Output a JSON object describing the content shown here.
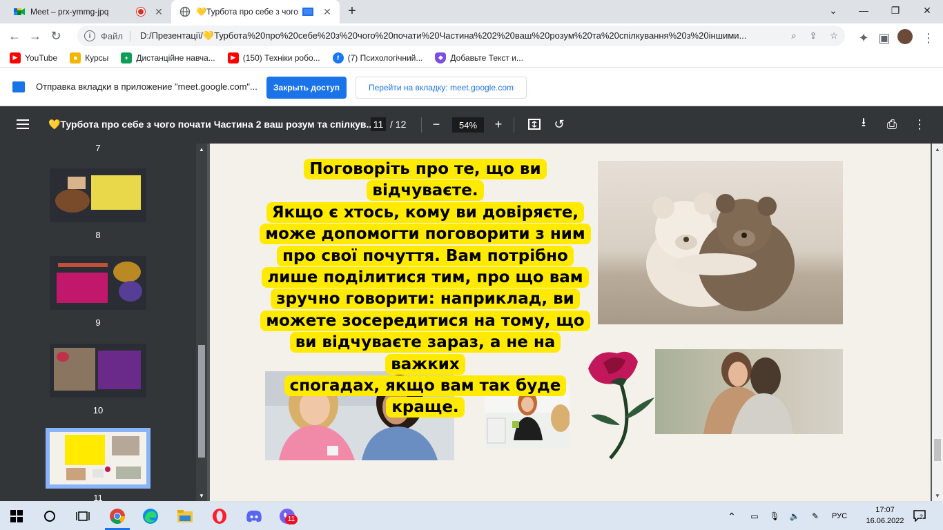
{
  "tabs": [
    {
      "title": "Meet – prx-ymmg-jpq",
      "icon": "google-meet-icon",
      "recording": true
    },
    {
      "title": "💛Турбота про себе з чого",
      "icon": "globe-icon",
      "sharing": true
    }
  ],
  "omnibox": {
    "scheme_label": "Файл",
    "url": "D:/Презентації/💛Турбота%20про%20себе%20з%20чого%20почати%20Частина%202%20ваш%20розум%20та%20спілкування%20з%20іншими..."
  },
  "bookmarks": [
    {
      "label": "YouTube",
      "icon": "youtube-icon",
      "color": "#ff0000"
    },
    {
      "label": "Курсы",
      "icon": "classroom-icon",
      "color": "#f4b400"
    },
    {
      "label": "Дистанційне навча...",
      "icon": "cross-icon",
      "color": "#0f9d58"
    },
    {
      "label": "(150) Техніки робо...",
      "icon": "youtube-icon",
      "color": "#ff0000"
    },
    {
      "label": "(7) Психологічний...",
      "icon": "facebook-icon",
      "color": "#1877f2"
    },
    {
      "label": "Добавьте Текст и...",
      "icon": "shield-icon",
      "color": "#7b4ee4"
    }
  ],
  "infobar": {
    "message": "Отправка вкладки в приложение \"meet.google.com\"...",
    "primary_button": "Закрыть доступ",
    "secondary_button": "Перейти на вкладку: meet.google.com"
  },
  "pdf": {
    "title": "💛Турбота про себе з чого почати Частина 2 ваш розум та спілкув...",
    "current_page": "11",
    "total_pages": "/ 12",
    "zoom": "54%"
  },
  "thumbnails": [
    {
      "label": "7"
    },
    {
      "label": "8"
    },
    {
      "label": "9"
    },
    {
      "label": "10"
    },
    {
      "label": "11",
      "selected": true
    }
  ],
  "slide": {
    "quote_lines": [
      "Поговоріть про те, що ви",
      "відчуваєте.",
      "Якщо є хтось, кому ви довіряєте,",
      "може допомогти поговорити з ним",
      "про свої почуття. Вам потрібно",
      "лише поділитися тим, про що вам",
      "зручно говорити: наприклад, ви",
      "можете зосередитися на тому, що",
      "ви відчуваєте зараз, а не на важких",
      "спогадах, якщо вам так буде краще."
    ],
    "highlight_color": "#ffea00"
  },
  "taskbar": {
    "apps": [
      "windows-start-icon",
      "search-circle-icon",
      "task-view-icon",
      "chrome-icon",
      "edge-icon",
      "file-explorer-icon",
      "opera-icon",
      "discord-icon",
      "viber-icon"
    ],
    "viber_badge": "11",
    "lang": "РУС",
    "time": "17:07",
    "date": "16.06.2022",
    "notification_count": "2"
  }
}
